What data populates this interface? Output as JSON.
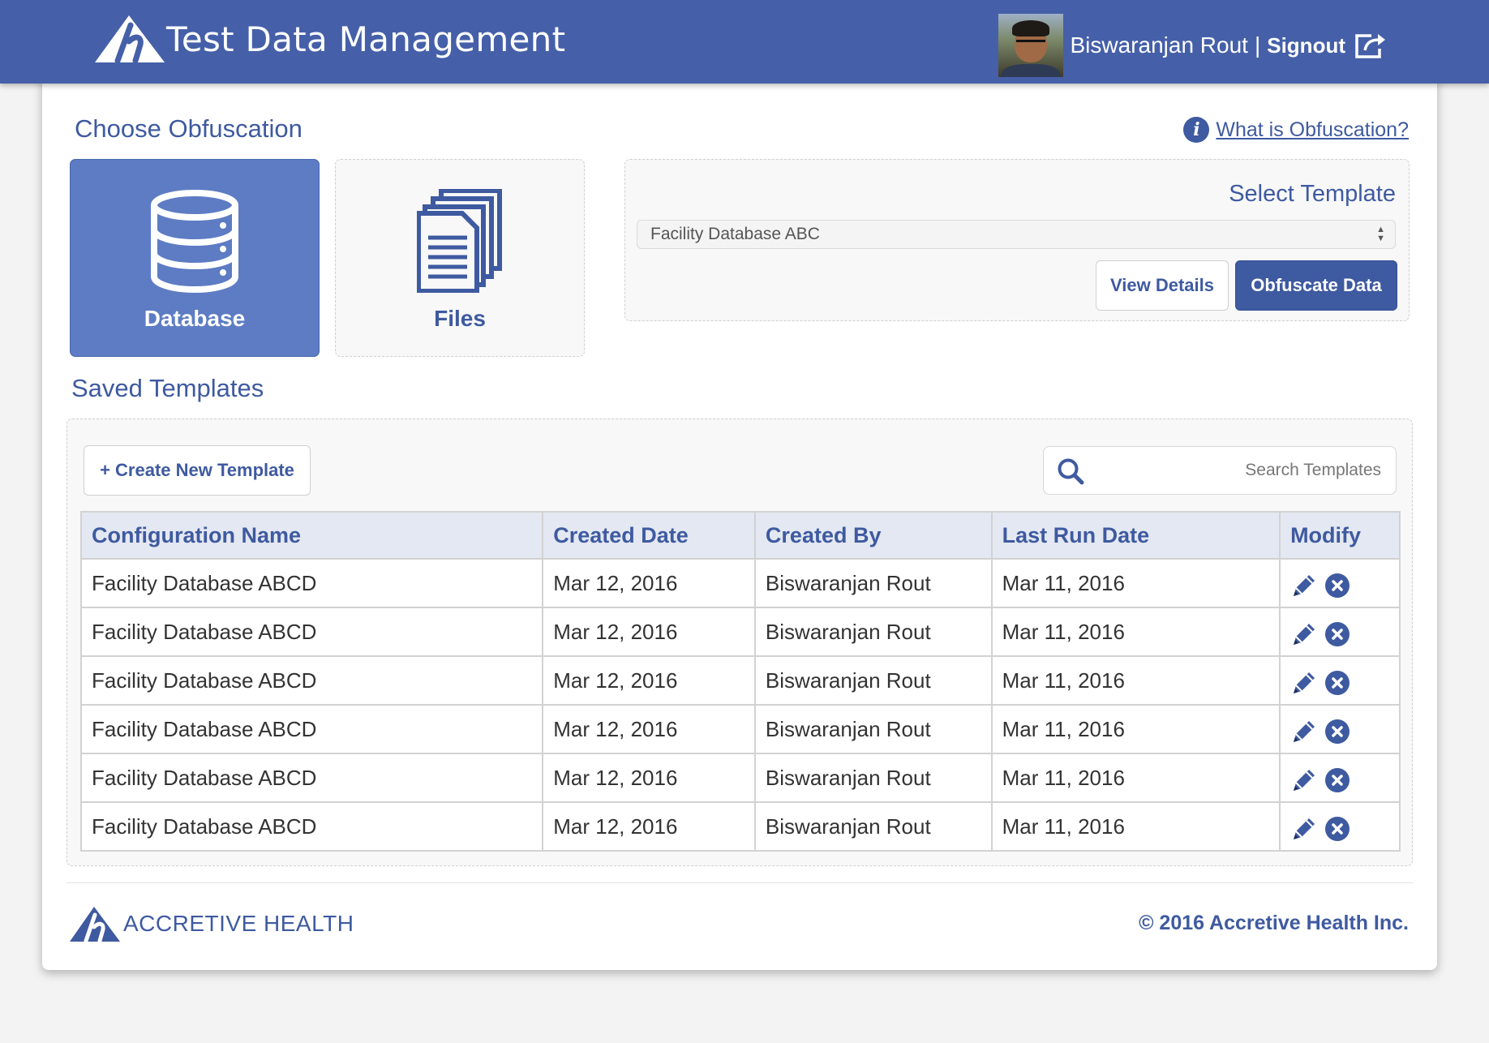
{
  "app": {
    "title": "Test Data Management"
  },
  "user": {
    "name": "Biswaranjan Rout",
    "separator": "|",
    "signout_label": "Signout"
  },
  "choose": {
    "title": "Choose Obfuscation",
    "help_link": "What is Obfuscation?",
    "options": [
      {
        "label": "Database",
        "icon": "database-icon",
        "selected": true
      },
      {
        "label": "Files",
        "icon": "files-icon",
        "selected": false
      }
    ]
  },
  "template_select": {
    "title": "Select Template",
    "selected_value": "Facility Database ABC",
    "view_details_label": "View Details",
    "obfuscate_label": "Obfuscate Data"
  },
  "saved": {
    "title": "Saved Templates",
    "create_label": "+ Create New Template",
    "search_placeholder": "Search Templates",
    "columns": [
      "Configuration Name",
      "Created Date",
      "Created By",
      "Last Run Date",
      "Modify"
    ],
    "rows": [
      [
        "Facility Database ABCD",
        "Mar 12, 2016",
        "Biswaranjan Rout",
        "Mar 11, 2016"
      ],
      [
        "Facility Database ABCD",
        "Mar 12, 2016",
        "Biswaranjan Rout",
        "Mar 11, 2016"
      ],
      [
        "Facility Database ABCD",
        "Mar 12, 2016",
        "Biswaranjan Rout",
        "Mar 11, 2016"
      ],
      [
        "Facility Database ABCD",
        "Mar 12, 2016",
        "Biswaranjan Rout",
        "Mar 11, 2016"
      ],
      [
        "Facility Database ABCD",
        "Mar 12, 2016",
        "Biswaranjan Rout",
        "Mar 11, 2016"
      ],
      [
        "Facility Database ABCD",
        "Mar 12, 2016",
        "Biswaranjan Rout",
        "Mar 11, 2016"
      ]
    ]
  },
  "footer": {
    "brand": "ACCRETIVE HEALTH",
    "copyright": "© 2016 Accretive Health Inc."
  },
  "colors": {
    "brand_blue": "#4560a8",
    "accent": "#3e5aa0",
    "selected_tile": "#5d7cc4"
  }
}
